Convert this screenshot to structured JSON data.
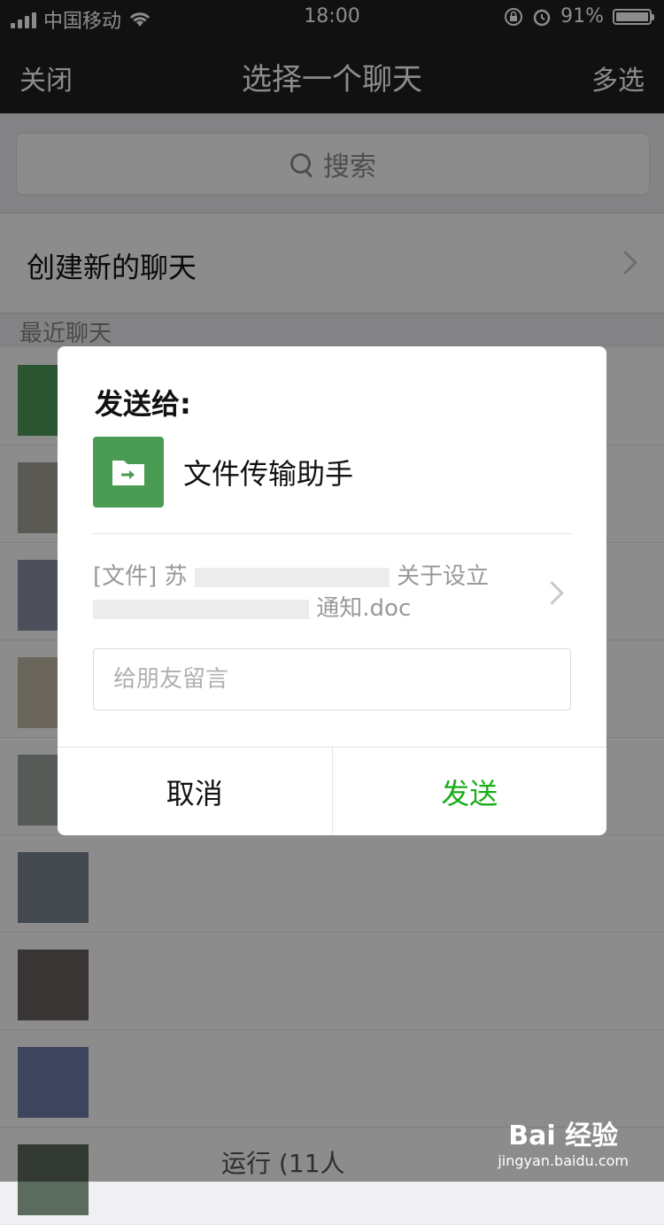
{
  "status_bar": {
    "carrier": "中国移动",
    "time": "18:00",
    "battery": "91%"
  },
  "nav": {
    "left": "关闭",
    "title": "选择一个聊天",
    "right": "多选"
  },
  "search": {
    "placeholder": "搜索"
  },
  "create_chat": {
    "label": "创建新的聊天"
  },
  "recent": {
    "header": "最近聊天",
    "last_visible_name": "运行 (11人"
  },
  "dialog": {
    "title": "发送给:",
    "recipient": "文件传输助手",
    "file_line1": "[文件] 苏",
    "file_line1_end": "关于设立",
    "file_line2": "通知.doc",
    "message_placeholder": "给朋友留言",
    "cancel": "取消",
    "send": "发送"
  },
  "watermark": {
    "brand": "Bai 经验",
    "url": "jingyan.baidu.com"
  },
  "colors": {
    "nav_bg": "#1f1f1f",
    "accent_green": "#1aad19",
    "file_assistant_green": "#4a9b54"
  }
}
